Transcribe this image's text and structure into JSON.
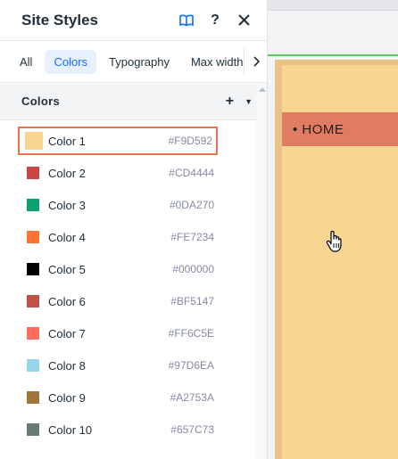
{
  "panel": {
    "title": "Site Styles",
    "icons": {
      "help_book": "book-icon",
      "help": "?",
      "close": "close-icon"
    }
  },
  "tabs": [
    {
      "label": "All",
      "active": false
    },
    {
      "label": "Colors",
      "active": true
    },
    {
      "label": "Typography",
      "active": false
    },
    {
      "label": "Max width",
      "active": false
    }
  ],
  "section": {
    "title": "Colors",
    "add_label": "+",
    "caret": "▼"
  },
  "colors": [
    {
      "name": "Color 1",
      "hex": "#F9D592",
      "selected": true
    },
    {
      "name": "Color 2",
      "hex": "#CD4444",
      "selected": false
    },
    {
      "name": "Color 3",
      "hex": "#0DA270",
      "selected": false
    },
    {
      "name": "Color 4",
      "hex": "#FE7234",
      "selected": false
    },
    {
      "name": "Color 5",
      "hex": "#000000",
      "selected": false
    },
    {
      "name": "Color 6",
      "hex": "#BF5147",
      "selected": false
    },
    {
      "name": "Color 7",
      "hex": "#FF6C5E",
      "selected": false
    },
    {
      "name": "Color 8",
      "hex": "#97D6EA",
      "selected": false
    },
    {
      "name": "Color 9",
      "hex": "#A2753A",
      "selected": false
    },
    {
      "name": "Color 10",
      "hex": "#657C73",
      "selected": false
    }
  ],
  "canvas": {
    "menu_item": "• HOME"
  },
  "theme": {
    "accent": "#116dff",
    "selection_outline": "#e8724e",
    "divider_green": "#5cc85c"
  }
}
